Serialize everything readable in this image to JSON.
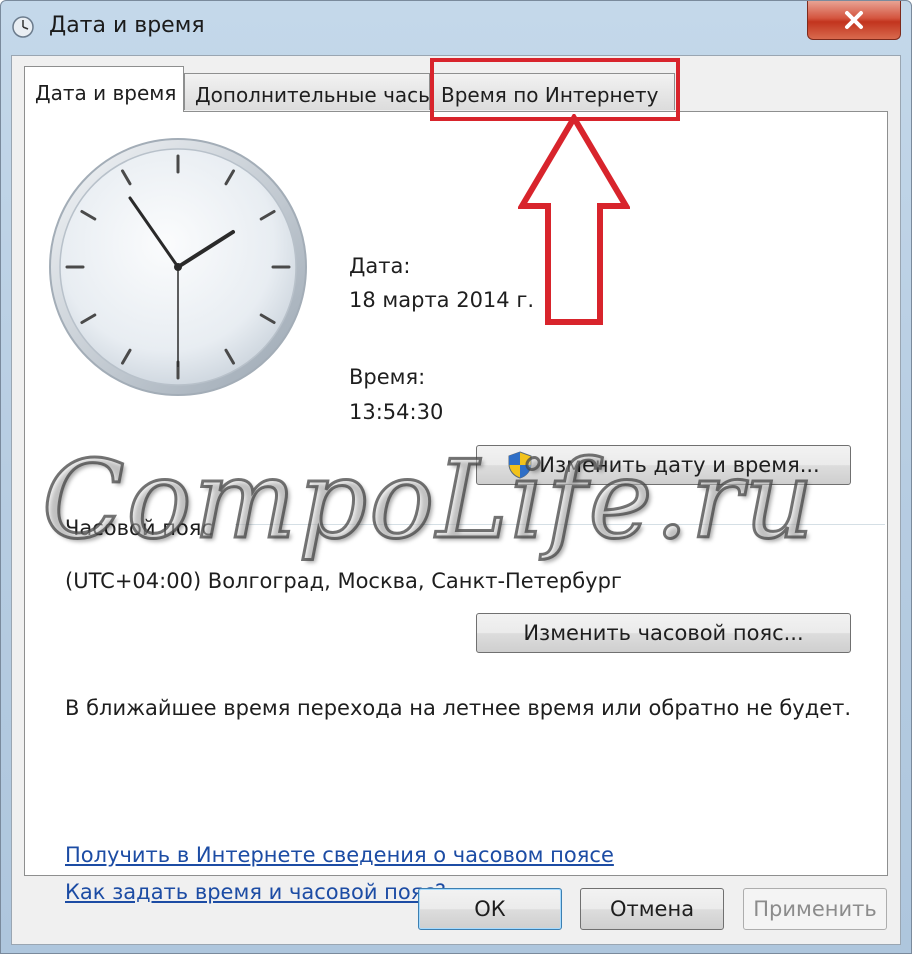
{
  "window": {
    "title": "Дата и время"
  },
  "tabs": [
    {
      "label": "Дата и время"
    },
    {
      "label": "Дополнительные часы"
    },
    {
      "label": "Время по Интернету"
    }
  ],
  "datetime": {
    "date_label": "Дата:",
    "date_value": "18 марта 2014 г.",
    "time_label": "Время:",
    "time_value": "13:54:30",
    "change_button": "Изменить дату и время..."
  },
  "timezone": {
    "label": "Часовой пояс",
    "value": "(UTC+04:00) Волгоград, Москва, Санкт-Петербург",
    "change_button": "Изменить часовой пояс..."
  },
  "dst_notice": "В ближайшее время перехода на летнее время или обратно не будет.",
  "links": [
    {
      "label": "Получить в Интернете сведения о часовом поясе"
    },
    {
      "label": "Как задать время и часовой пояс?"
    }
  ],
  "footer": {
    "ok": "ОК",
    "cancel": "Отмена",
    "apply": "Применить"
  },
  "watermark": "CompoLife.ru",
  "colors": {
    "highlight": "#d8242c",
    "link": "#1c4ca4",
    "close_button": "#c2341e"
  },
  "icons": [
    "clock-app-icon",
    "close-icon",
    "uac-shield-icon",
    "arrow-up-icon"
  ]
}
